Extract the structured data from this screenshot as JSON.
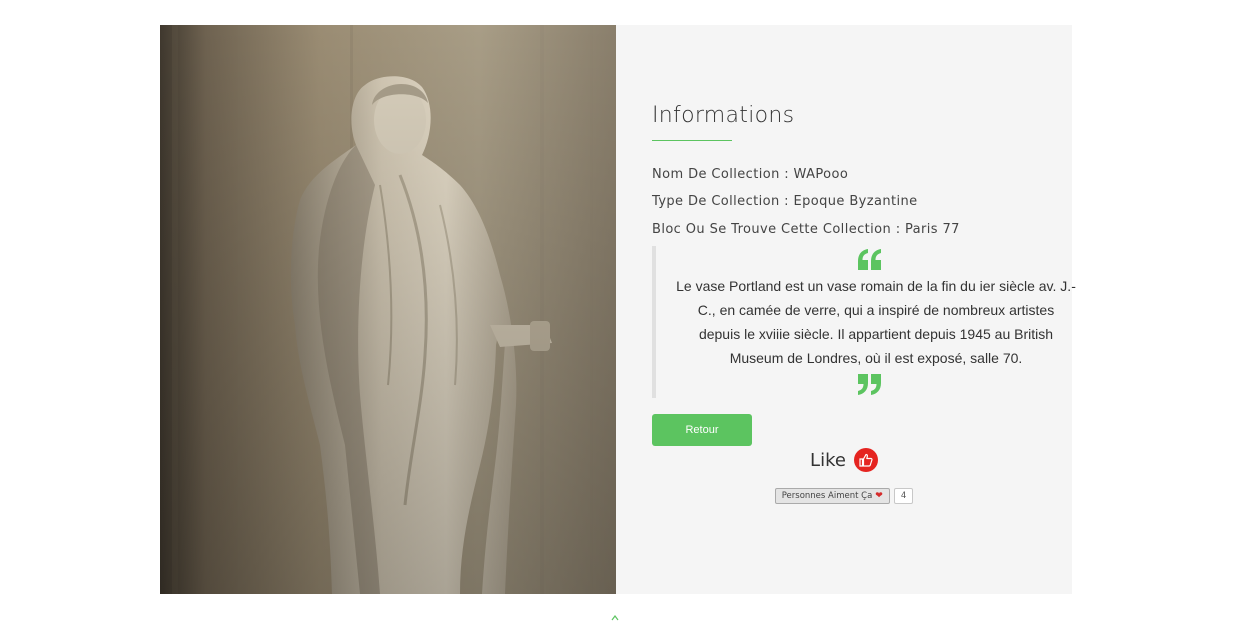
{
  "image": {
    "alt": "",
    "icon": "statue-photo"
  },
  "info": {
    "title": "Informations",
    "collection_name": "Nom De Collection : WAPooo",
    "collection_type": "Type De Collection : Epoque Byzantine",
    "collection_block": "Bloc Ou Se Trouve Cette Collection : Paris 77"
  },
  "quote": {
    "text": "Le vase Portland est un vase romain de la fin du ier siècle av. J.-C., en camée de verre, qui a inspiré de nombreux artistes depuis le xviiie siècle. Il appartient depuis 1945 au British Museum de Londres, où il est exposé, salle 70.",
    "open_icon": "quote-open-icon",
    "close_icon": "quote-close-icon"
  },
  "actions": {
    "back_label": "Retour",
    "like_label": "Like",
    "like_icon": "thumbs-up-icon"
  },
  "likes": {
    "label": "Personnes Aiment Ça",
    "heart": "❤",
    "count": "4"
  },
  "colors": {
    "accent": "#5cc460",
    "like": "#e52420",
    "panel_bg": "#f5f5f5"
  }
}
